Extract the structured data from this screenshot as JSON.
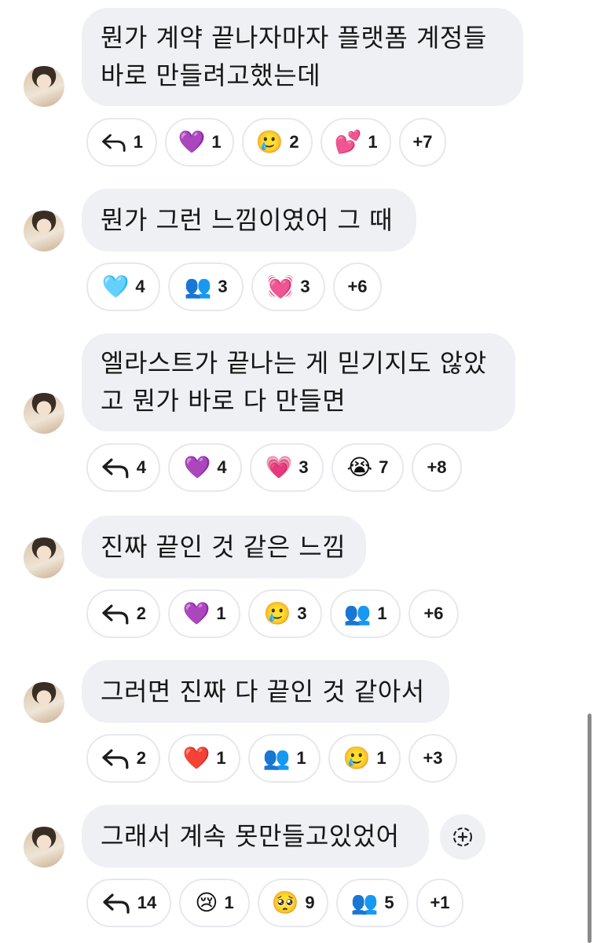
{
  "messages": [
    {
      "lines": [
        "뭔가 계약 끝나자마자 플랫폼 계정들",
        "바로 만들려고했는데"
      ],
      "reactions": [
        {
          "type": "reply",
          "icon": "reply-icon",
          "count": "1"
        },
        {
          "type": "emoji",
          "icon": "purple-heart-icon",
          "emoji": "💜",
          "count": "1"
        },
        {
          "type": "emoji",
          "icon": "holding-back-tears-icon",
          "emoji": "🥲",
          "count": "2"
        },
        {
          "type": "emoji",
          "icon": "two-hearts-icon",
          "emoji": "💕",
          "count": "1"
        },
        {
          "type": "more",
          "count": "+7"
        }
      ]
    },
    {
      "lines": [
        "뭔가 그런 느낌이였어 그 때"
      ],
      "reactions": [
        {
          "type": "emoji",
          "icon": "light-blue-heart-icon",
          "emoji": "🩵",
          "count": "4"
        },
        {
          "type": "emoji",
          "icon": "busts-icon",
          "emoji": "👥",
          "count": "3"
        },
        {
          "type": "emoji",
          "icon": "beating-heart-icon",
          "emoji": "💓",
          "count": "3"
        },
        {
          "type": "more",
          "count": "+6"
        }
      ]
    },
    {
      "lines": [
        "엘라스트가 끝나는 게 믿기지도 않았",
        "고 뭔가 바로 다 만들면"
      ],
      "reactions": [
        {
          "type": "reply",
          "icon": "reply-icon",
          "count": "4"
        },
        {
          "type": "emoji",
          "icon": "purple-heart-icon",
          "emoji": "💜",
          "count": "4"
        },
        {
          "type": "emoji",
          "icon": "growing-heart-icon",
          "emoji": "💗",
          "count": "3"
        },
        {
          "type": "emoji",
          "icon": "loudly-crying-icon",
          "emoji": "😭",
          "count": "7"
        },
        {
          "type": "more",
          "count": "+8"
        }
      ]
    },
    {
      "lines": [
        "진짜 끝인 것 같은 느낌"
      ],
      "reactions": [
        {
          "type": "reply",
          "icon": "reply-icon",
          "count": "2"
        },
        {
          "type": "emoji",
          "icon": "purple-heart-icon",
          "emoji": "💜",
          "count": "1"
        },
        {
          "type": "emoji",
          "icon": "holding-back-tears-icon",
          "emoji": "🥲",
          "count": "3"
        },
        {
          "type": "emoji",
          "icon": "busts-icon",
          "emoji": "👥",
          "count": "1"
        },
        {
          "type": "more",
          "count": "+6"
        }
      ]
    },
    {
      "lines": [
        "그러면 진짜 다 끝인 것 같아서"
      ],
      "reactions": [
        {
          "type": "reply",
          "icon": "reply-icon",
          "count": "2"
        },
        {
          "type": "emoji",
          "icon": "red-heart-icon",
          "emoji": "❤️",
          "count": "1"
        },
        {
          "type": "emoji",
          "icon": "busts-icon",
          "emoji": "👥",
          "count": "1"
        },
        {
          "type": "emoji",
          "icon": "holding-back-tears-icon",
          "emoji": "🥲",
          "count": "1"
        },
        {
          "type": "more",
          "count": "+3"
        }
      ]
    },
    {
      "lines": [
        "그래서 계속 못만들고있었어"
      ],
      "has_add_reaction": true,
      "reactions": [
        {
          "type": "reply",
          "icon": "reply-icon",
          "count": "14"
        },
        {
          "type": "emoji",
          "icon": "crying-face-icon",
          "emoji": "😢",
          "count": "1"
        },
        {
          "type": "emoji",
          "icon": "pleading-face-icon",
          "emoji": "🥺",
          "count": "9"
        },
        {
          "type": "emoji",
          "icon": "busts-icon",
          "emoji": "👥",
          "count": "5"
        },
        {
          "type": "more",
          "count": "+1"
        }
      ]
    }
  ]
}
